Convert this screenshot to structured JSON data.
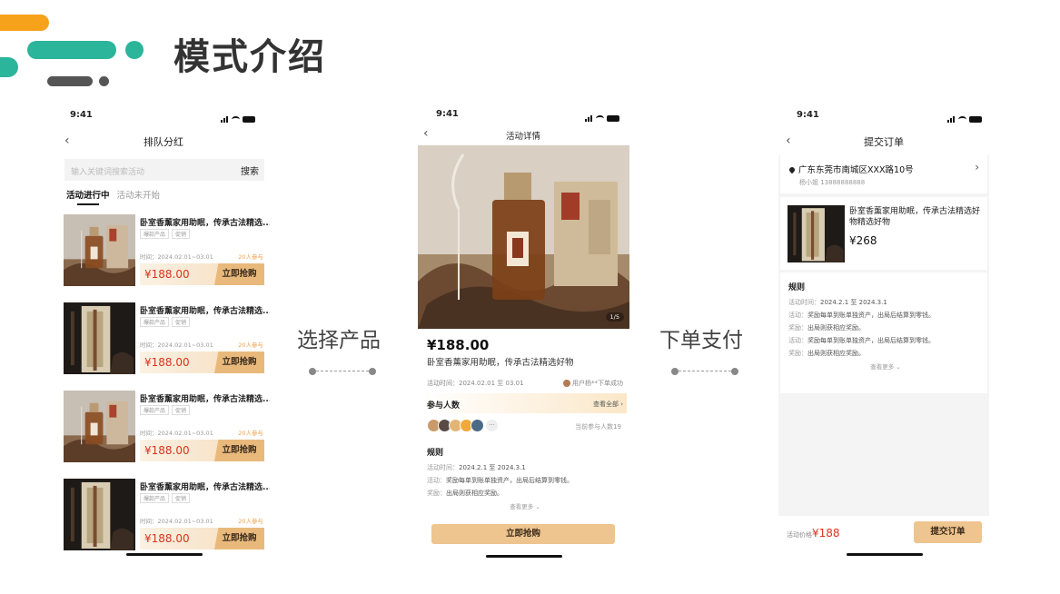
{
  "slide": {
    "title": "模式介绍"
  },
  "steps": {
    "step1": "选择产品",
    "step2": "下单支付"
  },
  "status_time": "9:41",
  "screen1": {
    "nav_title": "排队分红",
    "search_placeholder": "输入关键词搜索活动",
    "search_button": "搜索",
    "tab_active": "活动进行中",
    "tab_inactive": "活动未开始",
    "cards": [
      {
        "title": "卧室香薰家用助眠，传承古法精选...",
        "tags": [
          "爆款产品",
          "促销"
        ],
        "time": "时间：2024.02.01~03.01",
        "joined": "20人参与",
        "price": "¥188.00",
        "buy": "立即抢购",
        "image": "perfume-bottle"
      },
      {
        "title": "卧室香薰家用助眠，传承古法精选...",
        "tags": [
          "爆款产品",
          "促销"
        ],
        "time": "时间：2024.02.01~03.01",
        "joined": "20人参与",
        "price": "¥188.00",
        "buy": "立即抢购",
        "image": "incense-box"
      },
      {
        "title": "卧室香薰家用助眠，传承古法精选...",
        "tags": [
          "爆款产品",
          "促销"
        ],
        "time": "时间：2024.02.01~03.01",
        "joined": "20人参与",
        "price": "¥188.00",
        "buy": "立即抢购",
        "image": "perfume-bottle"
      },
      {
        "title": "卧室香薰家用助眠，传承古法精选...",
        "tags": [
          "爆款产品",
          "促销"
        ],
        "time": "时间：2024.02.01~03.01",
        "joined": "20人参与",
        "price": "¥188.00",
        "buy": "立即抢购",
        "image": "incense-box"
      }
    ]
  },
  "screen2": {
    "nav_title": "活动详情",
    "image_counter": "1/5",
    "price": "¥188.00",
    "product_name": "卧室香薰家用助眠，传承古法精选好物",
    "activity_time": "活动时间：2024.02.01 至 03.01",
    "recent_user": "用户杨**下单成功",
    "participants_label": "参与人数",
    "view_all": "查看全部 ›",
    "participant_count": "当前参与人数19",
    "avatars_more": "···",
    "rules_title": "规则",
    "rules": [
      {
        "k": "活动时间：",
        "v": "2024.2.1 至 2024.3.1"
      },
      {
        "k": "活动：",
        "v": "奖励每单到账单独资产，出局后结算到零钱。"
      },
      {
        "k": "奖励：",
        "v": "出局则获相应奖励。"
      }
    ],
    "see_more": "查看更多 ⌄",
    "buy_button": "立即抢购"
  },
  "screen3": {
    "nav_title": "提交订单",
    "address": "广东东莞市南城区XXX路10号",
    "contact": "杨小姐 13888888888",
    "product_name": "卧室香薰家用助眠，传承古法精选好物精选好物",
    "price": "¥268",
    "rules_title": "规则",
    "rules": [
      {
        "k": "活动时间：",
        "v": "2024.2.1 至 2024.3.1"
      },
      {
        "k": "活动：",
        "v": "奖励每单到账单独资产，出局后结算到零钱。"
      },
      {
        "k": "奖励：",
        "v": "出局则获相应奖励。"
      },
      {
        "k": "活动：",
        "v": "奖励每单到账单独资产，出局后结算到零钱。"
      },
      {
        "k": "奖励：",
        "v": "出局则获相应奖励。"
      }
    ],
    "see_more": "查看更多 ⌄",
    "footer_label": "活动价格",
    "footer_price": "¥188",
    "submit_button": "提交订单"
  },
  "colors": {
    "accent_orange": "#f7a21b",
    "accent_teal": "#2bb59a",
    "price_red": "#d9341f",
    "button_gold": "#e9b97c"
  }
}
